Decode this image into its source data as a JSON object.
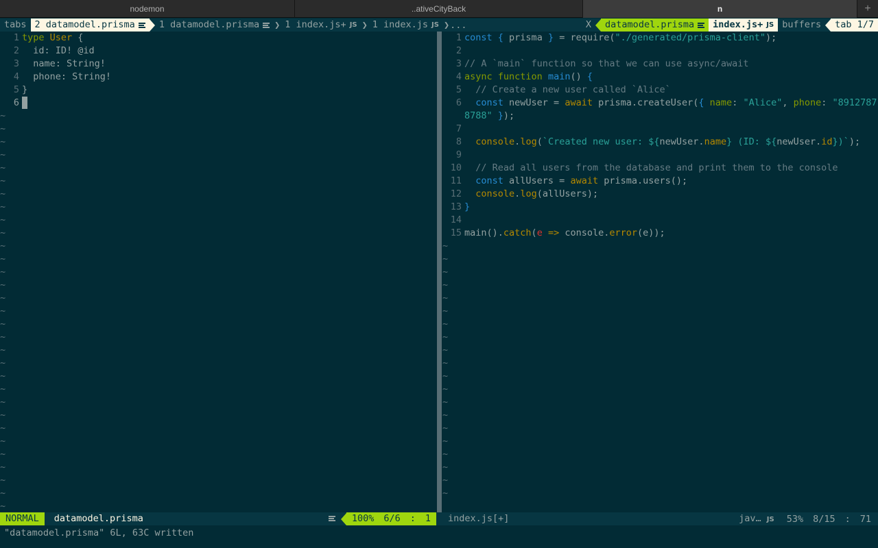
{
  "terminal_tabs": [
    {
      "label": "nodemon",
      "active": false
    },
    {
      "label": "..ativeCityBack",
      "active": false
    },
    {
      "label": "n",
      "active": true
    }
  ],
  "tabline": {
    "tabs_label": "tabs",
    "item1": "2 datamodel.prisma",
    "item2": "1 datamodel.prisma",
    "item3": "1 index.js+",
    "item4": "1 index.js",
    "ellipsis": "...",
    "close": "X",
    "buf1": "datamodel.prisma",
    "buf2": "index.js+",
    "buffers_label": "buffers",
    "tab_count": "tab 1/7",
    "js_badge": "JS"
  },
  "left_pane": {
    "lines": [
      "type User {",
      "  id: ID! @id",
      "  name: String!",
      "  phone: String!",
      "}",
      ""
    ],
    "tilde_count": 31
  },
  "right_pane": {
    "lines": [
      "const { prisma } = require(\"./generated/prisma-client\");",
      "",
      "// A `main` function so that we can use async/await",
      "async function main() {",
      "  // Create a new user called `Alice`",
      "  const newUser = await prisma.createUser({ name: \"Alice\", phone: \"8912787",
      "8788\" });",
      "",
      "  console.log(`Created new user: ${newUser.name} (ID: ${newUser.id})`);",
      "",
      "  // Read all users from the database and print them to the console",
      "  const allUsers = await prisma.users();",
      "  console.log(allUsers);",
      "}",
      "",
      "main().catch(e => console.error(e));"
    ],
    "line_numbers": [
      "1",
      "",
      "3",
      "4",
      "5",
      "6",
      "",
      "7",
      "8",
      "9",
      "10",
      "11",
      "12",
      "13",
      "14",
      "15"
    ],
    "tilde_count": 20
  },
  "status_left": {
    "mode": "NORMAL",
    "file": "datamodel.prisma",
    "percent": "100%",
    "position": "6/6",
    "col": "1"
  },
  "status_right": {
    "file": "index.js[+]",
    "filetype": "jav…",
    "percent": "53%",
    "position": "8/15",
    "col": "71"
  },
  "cmdline": "\"datamodel.prisma\" 6L, 63C written"
}
